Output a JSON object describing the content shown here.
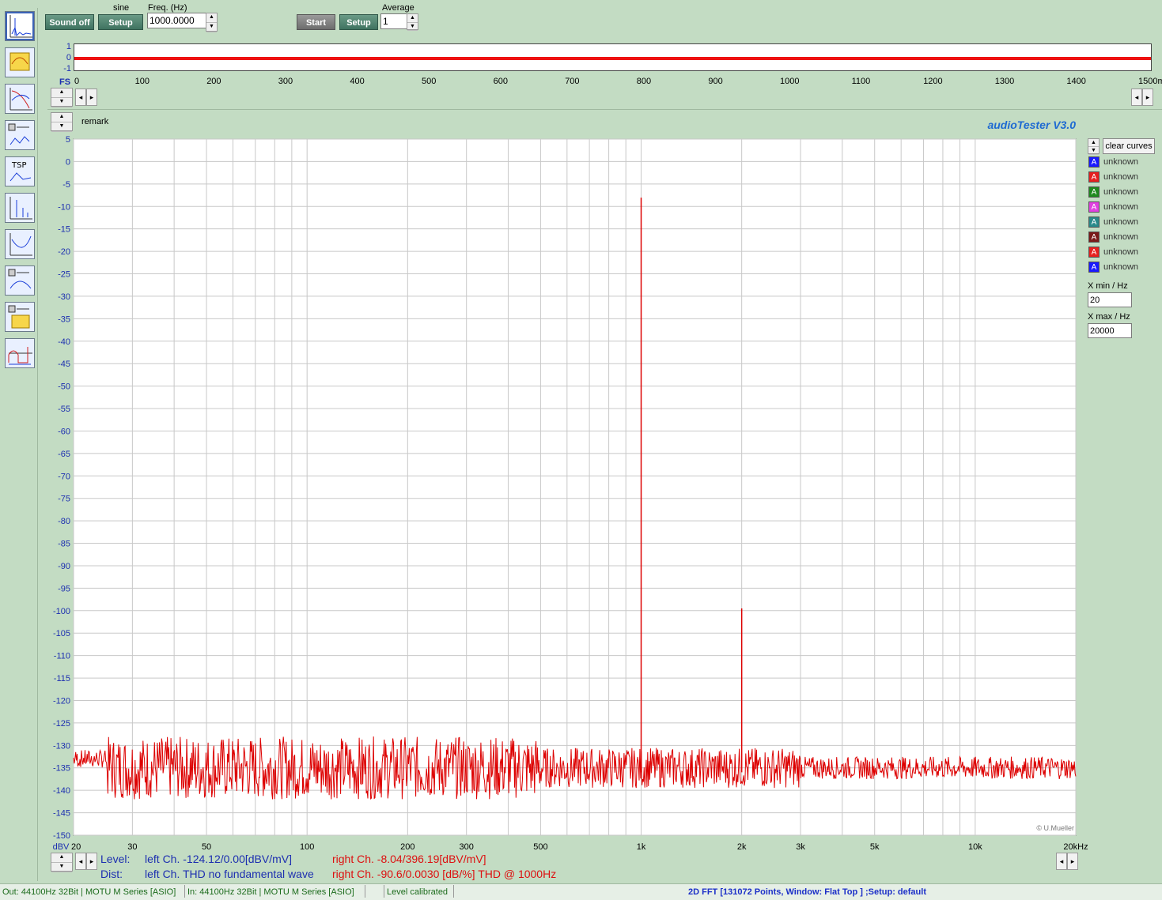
{
  "toolbar": {
    "signal_label": "sine",
    "sound_off_label": "Sound off",
    "setup_label": "Setup",
    "freq_label": "Freq. (Hz)",
    "freq_value": "1000.0000",
    "start_label": "Start",
    "setup2_label": "Setup",
    "average_label": "Average",
    "average_value": "1"
  },
  "scope": {
    "y_labels": [
      "1",
      "0",
      "-1"
    ],
    "fs_label": "FS",
    "x_ticks": [
      "0",
      "100",
      "200",
      "300",
      "400",
      "500",
      "600",
      "700",
      "800",
      "900",
      "1000",
      "1100",
      "1200",
      "1300",
      "1400",
      "1500ms"
    ]
  },
  "remark_label": "remark",
  "app_title": "audioTester  V3.0",
  "clear_curves_label": "clear curves",
  "legend": [
    {
      "name": "unknown",
      "color": "#1a1aff"
    },
    {
      "name": "unknown",
      "color": "#e62020"
    },
    {
      "name": "unknown",
      "color": "#1f8a1f"
    },
    {
      "name": "unknown",
      "color": "#e040e0"
    },
    {
      "name": "unknown",
      "color": "#2a8a8a"
    },
    {
      "name": "unknown",
      "color": "#7a1a1a"
    },
    {
      "name": "unknown",
      "color": "#e62020"
    },
    {
      "name": "unknown",
      "color": "#1a1aff"
    }
  ],
  "xmin": {
    "label": "X min / Hz",
    "value": "20"
  },
  "xmax": {
    "label": "X max / Hz",
    "value": "20000"
  },
  "copyright": "© U.Mueller",
  "chart_data": {
    "type": "line",
    "xscale": "log",
    "xlim": [
      20,
      20000
    ],
    "ylim": [
      -150,
      5
    ],
    "ylabel": "dBV",
    "x_tick_labels": [
      "20",
      "30",
      "50",
      "100",
      "200",
      "300",
      "500",
      "1k",
      "2k",
      "3k",
      "5k",
      "10k",
      "20kHz"
    ],
    "y_tick_labels": [
      "5",
      "0",
      "-5",
      "-10",
      "-15",
      "-20",
      "-25",
      "-30",
      "-35",
      "-40",
      "-45",
      "-50",
      "-55",
      "-60",
      "-65",
      "-70",
      "-75",
      "-80",
      "-85",
      "-90",
      "-95",
      "-100",
      "-105",
      "-110",
      "-115",
      "-120",
      "-125",
      "-130",
      "-135",
      "-140",
      "-145",
      "-150"
    ],
    "grid": true,
    "series": [
      {
        "color": "#dd0000",
        "noise_floor_db": -135,
        "peaks": [
          {
            "x": 1000,
            "y": -8.04
          },
          {
            "x": 2000,
            "y": -99.5
          }
        ]
      }
    ]
  },
  "readout": {
    "level_label": "Level:",
    "dist_label": "Dist:",
    "level_left": "left Ch. -124.12/0.00[dBV/mV]",
    "level_right": "right Ch. -8.04/396.19[dBV/mV]",
    "dist_left": "left Ch. THD no fundamental wave",
    "dist_right": "right Ch. -90.6/0.0030 [dB/%] THD @ 1000Hz"
  },
  "status": {
    "out": "Out: 44100Hz 32Bit  | MOTU M Series [ASIO]",
    "in": "In: 44100Hz 32Bit  | MOTU M Series [ASIO]",
    "calibrated": "Level calibrated",
    "fft": "2D FFT [131072 Points, Window: Flat Top ]  ;Setup:  default"
  }
}
